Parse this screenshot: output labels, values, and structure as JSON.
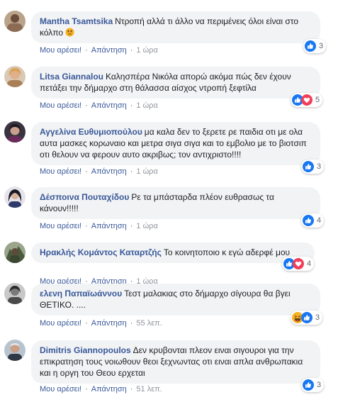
{
  "comments": [
    {
      "name": "Mantha Tsamtsika",
      "text": "Ντροπή αλλά τι άλλο να περιμένεις όλοι είναι στο κόλπο",
      "emoji": "angry-face-emoji",
      "like_label": "Μου αρέσει!",
      "reply_label": "Απάντηση",
      "time": "1 ώρα",
      "reactions": [
        "like-icon"
      ],
      "reaction_count": "3",
      "avatar": "avatar-photo"
    },
    {
      "name": "Litsa Giannalou",
      "text": "Καλησπέρα Νικόλα απορώ ακόμα πώς δεν έχουν πετάξει την δήμαρχο στη θάλασσα αίσχος ντροπή ξεφτίλα",
      "like_label": "Μου αρέσει!",
      "reply_label": "Απάντηση",
      "time": "1 ώρα",
      "reactions": [
        "like-icon",
        "love-icon"
      ],
      "reaction_count": "5",
      "avatar": "avatar-photo"
    },
    {
      "name": "Αγγελίνα Ευθυμιοπούλου",
      "text": "μα καλα δεν το ξερετε ρε παιδια οτι με ολα αυτα μασκες κορωναιο και μετρα σιγα σιγα και το εμβολιο με το βιοτσιπ οτι θελουν να φερουν αυτο ακριβως; τον αντιχριστο!!!!",
      "like_label": "Μου αρέσει!",
      "reply_label": "Απάντηση",
      "time": "1 ώρα",
      "reactions": [
        "like-icon"
      ],
      "reaction_count": "3",
      "avatar": "avatar-photo"
    },
    {
      "name": "Δέσποινα Πουταχίδου",
      "text": "Ρε τα μπάσταρδα πλέον ευθρασως τα κάνουν!!!!!",
      "like_label": "Μου αρέσει!",
      "reply_label": "Απάντηση",
      "time": "1 ώρα",
      "reactions": [
        "like-icon"
      ],
      "reaction_count": "4",
      "avatar": "avatar-photo"
    },
    {
      "name": "Ηρακλής Κομάντος Καταρτζής",
      "text": "Το κοινητοποιο κ εγώ αδερφέ μου",
      "like_label": "Μου αρέσει!",
      "reply_label": "Απάντηση",
      "time": "1 ώρα",
      "reactions": [
        "like-icon",
        "love-icon"
      ],
      "reaction_count": "4",
      "avatar": "avatar-photo"
    },
    {
      "name": "ελενη Παπαϊωάννου",
      "text": "Τεστ μαλακιας στο δήμαρχο σίγουρα θα βγει ΘΕΤΙΚΟ. ....",
      "like_label": "Μου αρέσει!",
      "reply_label": "Απάντηση",
      "time": "55 λεπ.",
      "reactions": [
        "haha-icon",
        "like-icon"
      ],
      "reaction_count": "3",
      "avatar": "avatar-photo"
    },
    {
      "name": "Dimitris Giannopoulos",
      "text": "Δεν κρυβονται πλεον ειναι σιγουροι για την επικρατηση τους νοιωθουν θεοι ξεχνωντας οτι ειναι απλα ανθρωπακια και η οργη του Θεου ερχεται",
      "like_label": "Μου αρέσει!",
      "reply_label": "Απάντηση",
      "time": "51 λεπ.",
      "reactions": [
        "like-icon"
      ],
      "reaction_count": "3",
      "avatar": "avatar-photo"
    }
  ],
  "colors": {
    "name_link": "#385898",
    "bubble_bg": "#f2f3f5",
    "like_blue": "#1877f2",
    "love_red": "#f33e58",
    "haha_yellow": "#f7b125",
    "meta_grey": "#90949c"
  }
}
